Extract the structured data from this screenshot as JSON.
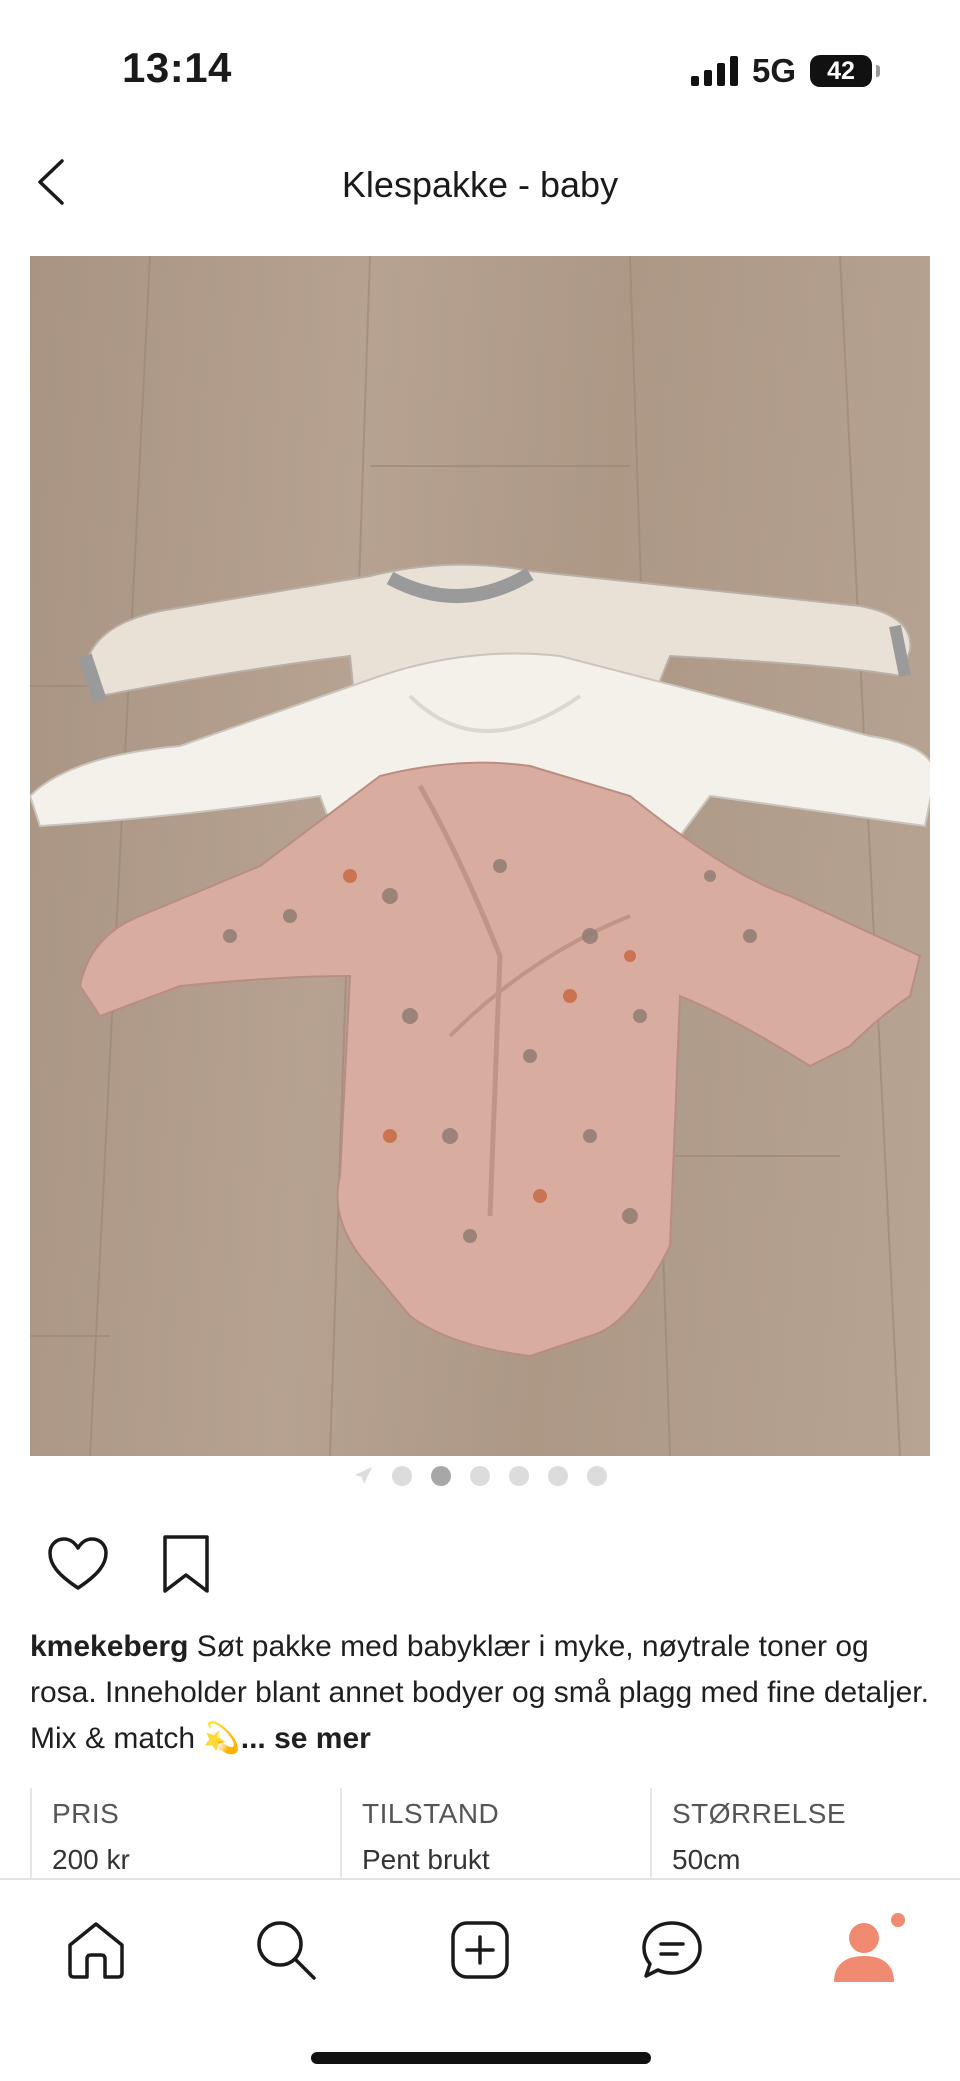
{
  "status_bar": {
    "time": "13:14",
    "network": "5G",
    "battery": "42"
  },
  "header": {
    "title": "Klespakke - baby"
  },
  "carousel": {
    "total_images": 6,
    "active_index": 1
  },
  "post": {
    "username": "kmekeberg",
    "text": "Søt pakke med babyklær i myke, nøytrale toner og rosa. Inneholder blant annet bodyer og små plagg med fine detaljer. Mix & match ",
    "emoji": "💫",
    "more_label": "... se mer"
  },
  "details": [
    {
      "key": "PRIS",
      "value": "200 kr"
    },
    {
      "key": "TILSTAND",
      "value": "Pent brukt"
    },
    {
      "key": "STØRRELSE",
      "value": "50cm"
    }
  ],
  "colors": {
    "accent": "#f08a70",
    "text": "#1a1a1a",
    "divider": "#e6e6e6"
  },
  "nav": [
    "home-icon",
    "search-icon",
    "add-icon",
    "messages-icon",
    "profile-icon"
  ]
}
